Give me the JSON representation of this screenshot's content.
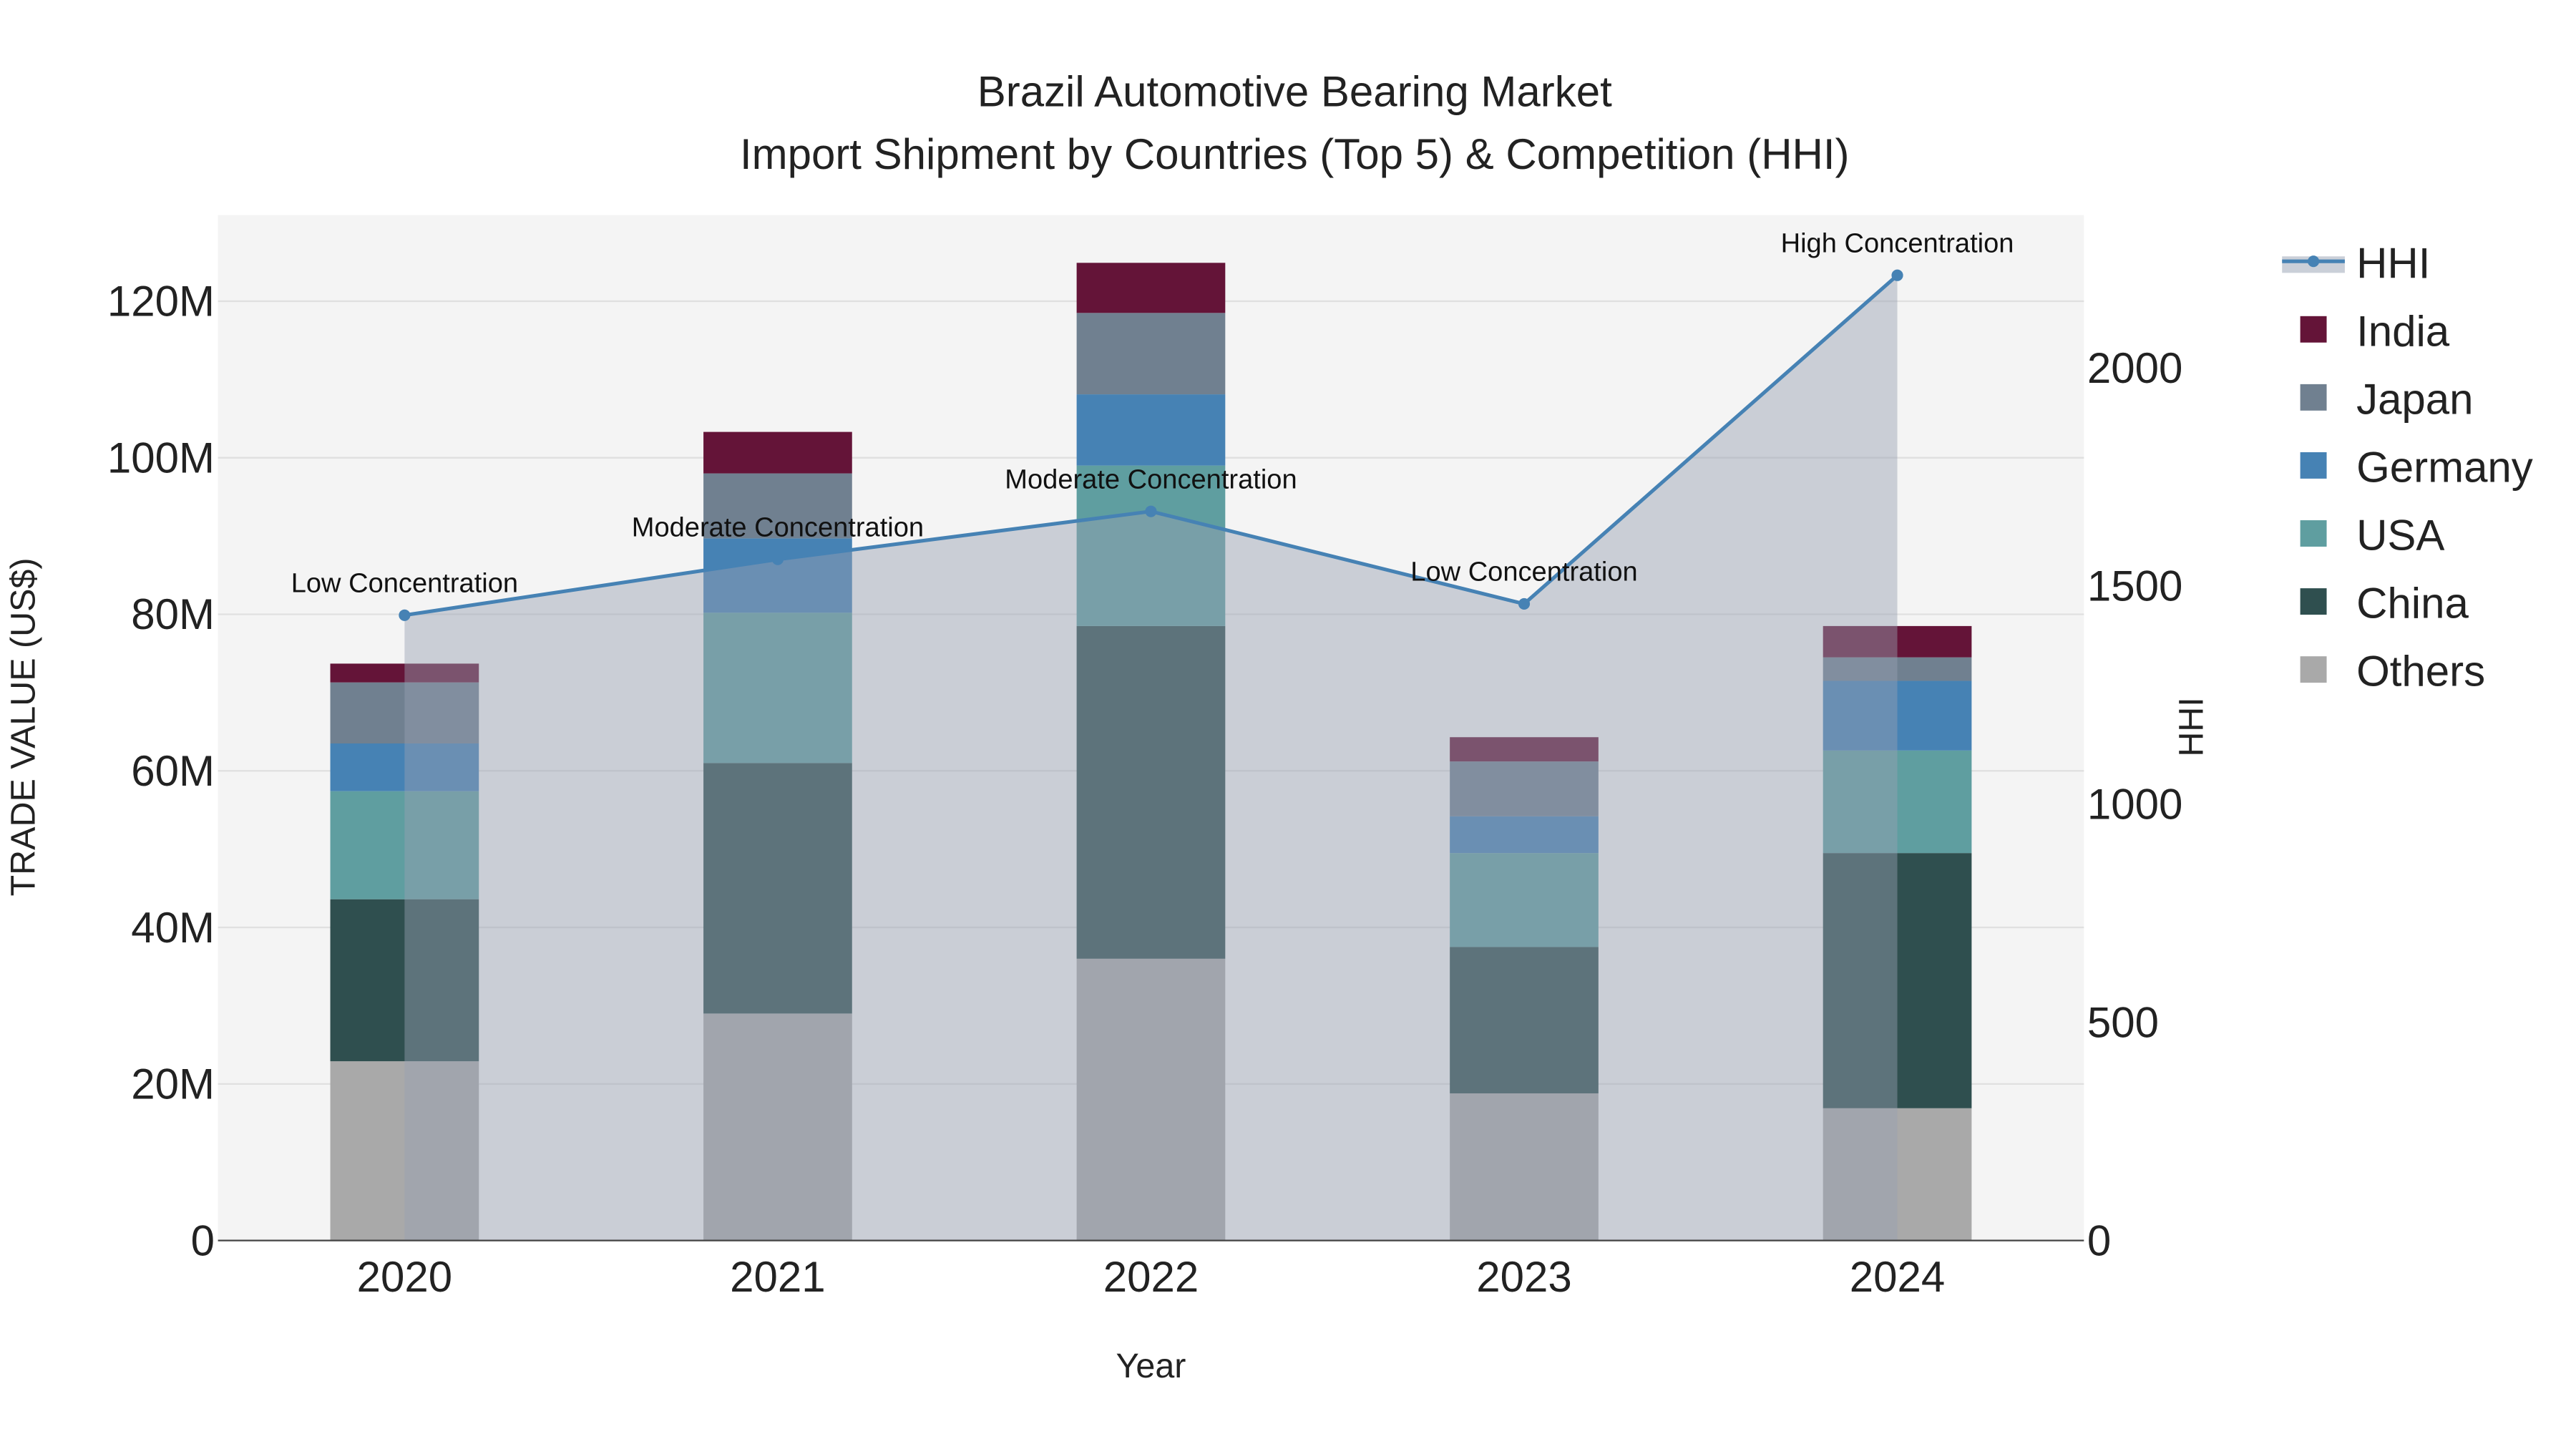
{
  "chart_data": {
    "type": "bar",
    "stacked": true,
    "title": "Brazil Automotive Bearing Market",
    "subtitle": "Import Shipment by Countries (Top 5) & Competition (HHI)",
    "xlabel": "Year",
    "ylabel": "TRADE VALUE (US$)",
    "y2label": "HHI",
    "categories": [
      "2020",
      "2021",
      "2022",
      "2023",
      "2024"
    ],
    "ylim": [
      0,
      131000000
    ],
    "y_ticks": [
      0,
      20000000,
      40000000,
      60000000,
      80000000,
      100000000,
      120000000
    ],
    "y_tick_labels": [
      "0",
      "20M",
      "40M",
      "60M",
      "80M",
      "100M",
      "120M"
    ],
    "y2lim": [
      0,
      2350
    ],
    "y2_ticks": [
      0,
      500,
      1000,
      1500,
      2000
    ],
    "y2_tick_labels": [
      "0",
      "500",
      "1000",
      "1500",
      "2000"
    ],
    "grid": true,
    "legend_position": "right",
    "series": [
      {
        "name": "Others",
        "color": "#a9a9a9",
        "values": [
          22900000,
          29000000,
          36000000,
          18800000,
          16900000
        ]
      },
      {
        "name": "China",
        "color": "#2f4f4f",
        "values": [
          20700000,
          32000000,
          42500000,
          18700000,
          32600000
        ]
      },
      {
        "name": "USA",
        "color": "#5f9ea0",
        "values": [
          13800000,
          19200000,
          20500000,
          12000000,
          13100000
        ]
      },
      {
        "name": "Germany",
        "color": "#4682b4",
        "values": [
          6100000,
          9500000,
          9100000,
          4700000,
          8900000
        ]
      },
      {
        "name": "Japan",
        "color": "#708090",
        "values": [
          7800000,
          8300000,
          10400000,
          7000000,
          3000000
        ]
      },
      {
        "name": "India",
        "color": "#641438",
        "values": [
          2400000,
          5300000,
          6400000,
          3100000,
          4000000
        ]
      }
    ],
    "hhi": {
      "name": "HHI",
      "color": "#4682b4",
      "values": [
        1433,
        1561,
        1671,
        1459,
        2212
      ],
      "annotations": [
        "Low Concentration",
        "Moderate Concentration",
        "Moderate Concentration",
        "Low Concentration",
        "High Concentration"
      ]
    },
    "legend_order": [
      "HHI",
      "India",
      "Japan",
      "Germany",
      "USA",
      "China",
      "Others"
    ]
  }
}
